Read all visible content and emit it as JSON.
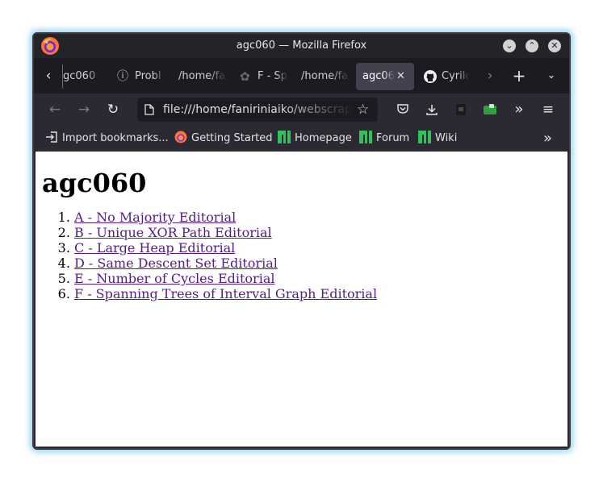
{
  "window": {
    "title": "agc060 — Mozilla Firefox"
  },
  "tabs": [
    {
      "label": "gc060",
      "icon": "none"
    },
    {
      "label": "Probl",
      "icon": "info-icon"
    },
    {
      "label": "/home/fa",
      "icon": "none"
    },
    {
      "label": "F - Sp",
      "icon": "atcoder-icon"
    },
    {
      "label": "/home/fa",
      "icon": "none"
    },
    {
      "label": "agc060",
      "icon": "none",
      "active": true
    },
    {
      "label": "Cyrilc",
      "icon": "github-icon"
    }
  ],
  "navbar": {
    "url": "file:///home/faniriniaiko/webscrapping"
  },
  "bookmarks": [
    {
      "label": "Import bookmarks...",
      "icon": "import-icon"
    },
    {
      "label": "Getting Started",
      "icon": "firefox-icon"
    },
    {
      "label": "Homepage",
      "icon": "manjaro-icon"
    },
    {
      "label": "Forum",
      "icon": "manjaro-icon"
    },
    {
      "label": "Wiki",
      "icon": "manjaro-icon"
    }
  ],
  "page": {
    "heading": "agc060",
    "links": [
      "A - No Majority Editorial",
      "B - Unique XOR Path Editorial",
      "C - Large Heap Editorial",
      "D - Same Descent Set Editorial",
      "E - Number of Cycles Editorial",
      "F - Spanning Trees of Interval Graph Editorial"
    ]
  },
  "colors": {
    "visited_link": "#551a8b",
    "window_glow": "#3daee9",
    "manjaro_green": "#35bf5c"
  }
}
